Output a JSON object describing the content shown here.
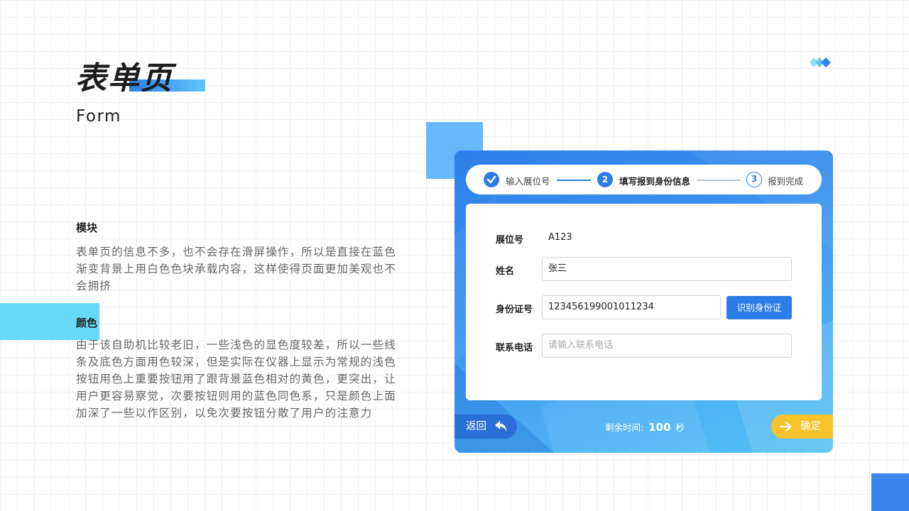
{
  "slide": {
    "title": "表单页",
    "subtitle": "Form"
  },
  "sections": [
    {
      "heading": "模块",
      "body": "表单页的信息不多，也不会存在滑屏操作，所以是直接在蓝色渐变背景上用白色色块承载内容，这样使得页面更加美观也不会拥挤"
    },
    {
      "heading": "颜色",
      "body": "由于该自助机比较老旧，一些浅色的显色度较差，所以一些线条及底色方面用色较深，但是实际在仪器上显示为常规的浅色\n按钮用色上重要按钮用了跟背景蓝色相对的黄色，更突出，让用户更容易察觉，次要按钮则用的蓝色同色系，只是颜色上面加深了一些以作区别，以免次要按钮分散了用户的注意力"
    }
  ],
  "device": {
    "steps": [
      {
        "number": "",
        "label": "输入展位号",
        "state": "done"
      },
      {
        "number": "2",
        "label": "填写报到身份信息",
        "state": "active"
      },
      {
        "number": "3",
        "label": "报到完成",
        "state": "todo"
      }
    ],
    "form": {
      "booth_label": "展位号",
      "booth_value": "A123",
      "name_label": "姓名",
      "name_value": "张三",
      "id_label": "身份证号",
      "id_value": "123456199001011234",
      "id_button": "识别身份证",
      "phone_label": "联系电话",
      "phone_placeholder": "请输入联系电话"
    },
    "footer": {
      "back_label": "返回",
      "timer_prefix": "剩余时间:",
      "timer_value": "100",
      "timer_unit": "秒",
      "confirm_label": "确定"
    }
  },
  "colors": {
    "primary_blue": "#2e7de6",
    "accent_yellow": "#f7c22a",
    "cyan_accent": "#5ed8f8"
  },
  "icons": [
    "check-icon",
    "back-arrow-icon",
    "right-arrow-icon",
    "diamonds-logo-icon"
  ]
}
